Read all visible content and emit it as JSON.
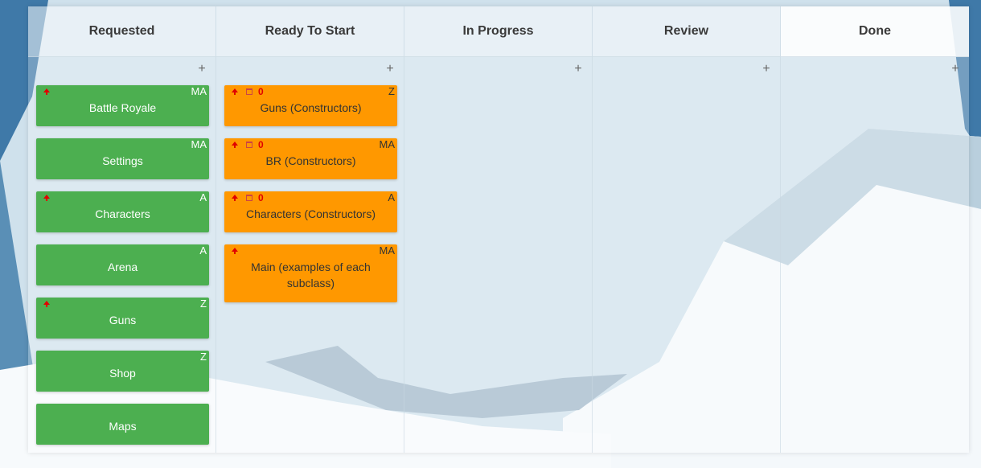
{
  "columns": [
    {
      "title": "Requested",
      "add": "+",
      "cards": [
        {
          "title": "Battle Royale",
          "assignee": "MA"
        },
        {
          "title": "Settings",
          "assignee": "MA"
        },
        {
          "title": "Characters",
          "assignee": "A"
        },
        {
          "title": "Arena",
          "assignee": "A"
        },
        {
          "title": "Guns",
          "assignee": "Z"
        },
        {
          "title": "Shop",
          "assignee": "Z"
        },
        {
          "title": "Maps",
          "assignee": ""
        }
      ]
    },
    {
      "title": "Ready To Start",
      "add": "+",
      "cards": [
        {
          "title": "Guns (Constructors)",
          "assignee": "Z",
          "due": "0"
        },
        {
          "title": "BR (Constructors)",
          "assignee": "MA",
          "due": "0"
        },
        {
          "title": "Characters (Constructors)",
          "assignee": "A",
          "due": "0"
        },
        {
          "title": "Main (examples of each subclass)",
          "assignee": "MA"
        }
      ]
    },
    {
      "title": "In Progress",
      "add": "+"
    },
    {
      "title": "Review",
      "add": "+"
    },
    {
      "title": "Done",
      "add": "+"
    }
  ],
  "colors": {
    "green_card": "#4caf50",
    "orange_card": "#ff9800",
    "priority": "#e00000"
  },
  "icons": {
    "priority": "priority-up-arrow-icon",
    "due": "calendar-icon",
    "add": "plus-icon"
  }
}
